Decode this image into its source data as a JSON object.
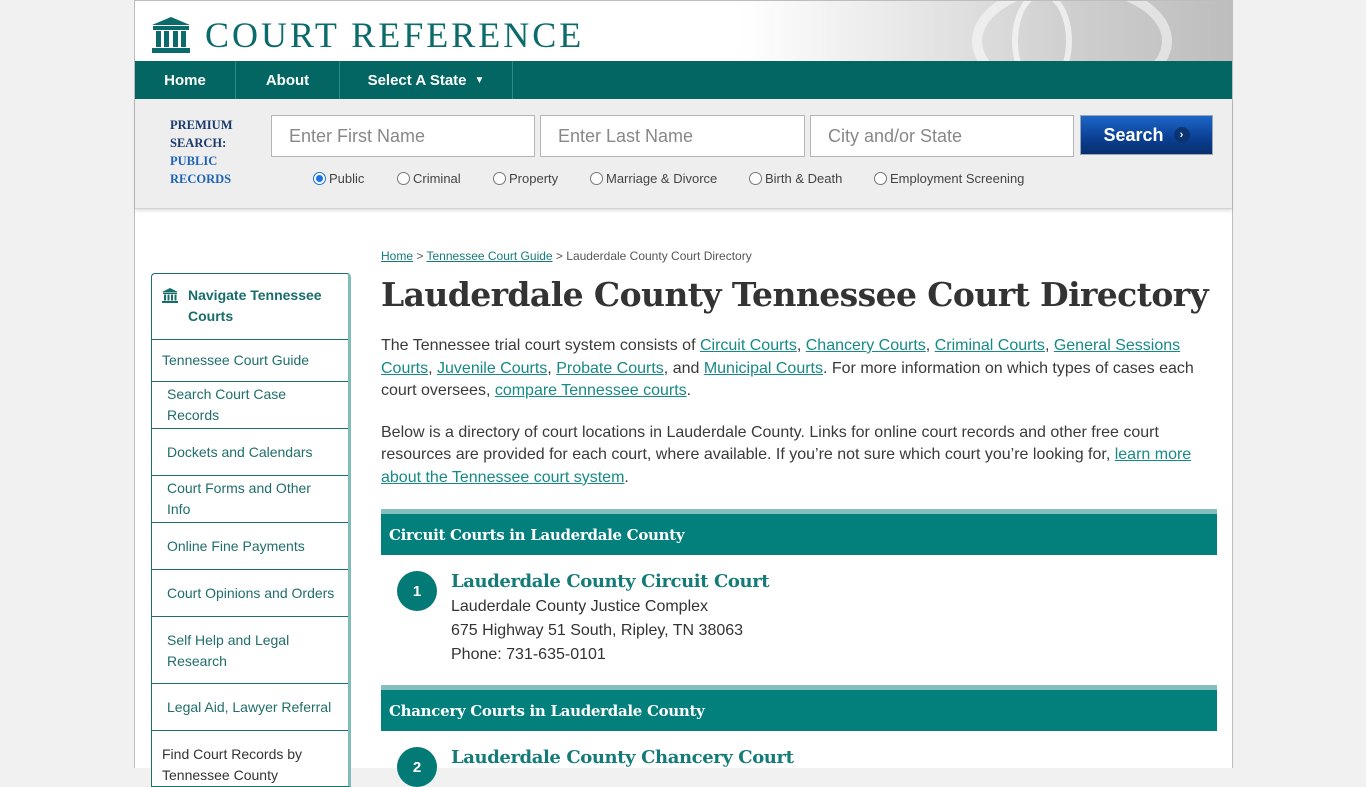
{
  "brand": {
    "name": "COURT REFERENCE",
    "primary_color": "#036663",
    "accent_color": "#037f7c"
  },
  "nav": {
    "items": [
      {
        "label": "Home"
      },
      {
        "label": "About"
      },
      {
        "label": "Select A State",
        "has_dropdown": true
      }
    ],
    "caret": "▼"
  },
  "search": {
    "premium_line1": "PREMIUM",
    "premium_line2": "SEARCH:",
    "premium_line3": "PUBLIC",
    "premium_line4": "RECORDS",
    "first_name_placeholder": "Enter First Name",
    "last_name_placeholder": "Enter Last Name",
    "location_placeholder": "City and/or State",
    "button_label": "Search",
    "button_arrow": "›",
    "options": [
      {
        "label": "Public",
        "selected": true
      },
      {
        "label": "Criminal",
        "selected": false
      },
      {
        "label": "Property",
        "selected": false
      },
      {
        "label": "Marriage & Divorce",
        "selected": false
      },
      {
        "label": "Birth & Death",
        "selected": false
      },
      {
        "label": "Employment Screening",
        "selected": false
      }
    ]
  },
  "sidebar": {
    "title": "Navigate Tennessee Courts",
    "items": [
      {
        "label": "Tennessee Court Guide"
      },
      {
        "label": "Search Court Case Records"
      },
      {
        "label": "Dockets and Calendars"
      },
      {
        "label": "Court Forms and Other Info"
      },
      {
        "label": "Online Fine Payments"
      },
      {
        "label": "Court Opinions and Orders"
      },
      {
        "label": "Self Help and Legal Research"
      },
      {
        "label": "Legal Aid, Lawyer Referral"
      },
      {
        "label": "Find Court Records by Tennessee County"
      }
    ]
  },
  "breadcrumb": {
    "home": "Home",
    "sep": ">",
    "guide": "Tennessee Court Guide",
    "current": "Lauderdale County Court Directory"
  },
  "page_title": "Lauderdale County Tennessee Court Directory",
  "intro": {
    "t1": "The Tennessee trial court system consists of ",
    "l1": "Circuit Courts",
    "c1": ", ",
    "l2": "Chancery Courts",
    "c2": ", ",
    "l3": "Criminal Courts",
    "c3": ", ",
    "l4": "General Sessions Courts",
    "c4": ", ",
    "l5": "Juvenile Courts",
    "c5": ", ",
    "l6": "Probate Courts",
    "c6": ", and ",
    "l7": "Municipal Courts",
    "t2": ". For more information on which types of cases each court oversees, ",
    "l8": "compare Tennessee courts",
    "t3": "."
  },
  "directory_intro": {
    "text": "Below is a directory of court locations in Lauderdale County. Links for online court records and other free court resources are provided for each court, where available. If you’re not sure which court you’re looking for, ",
    "link": "learn more about the Tennessee court system",
    "end": "."
  },
  "sections": [
    {
      "heading": "Circuit Courts in Lauderdale County",
      "courts": [
        {
          "number": "1",
          "name": "Lauderdale County Circuit Court",
          "building": "Lauderdale County Justice Complex",
          "address": "675 Highway 51 South, Ripley, TN 38063",
          "phone": "Phone: 731-635-0101"
        }
      ]
    },
    {
      "heading": "Chancery Courts in Lauderdale County",
      "courts": [
        {
          "number": "2",
          "name": "Lauderdale County Chancery Court"
        }
      ]
    }
  ]
}
